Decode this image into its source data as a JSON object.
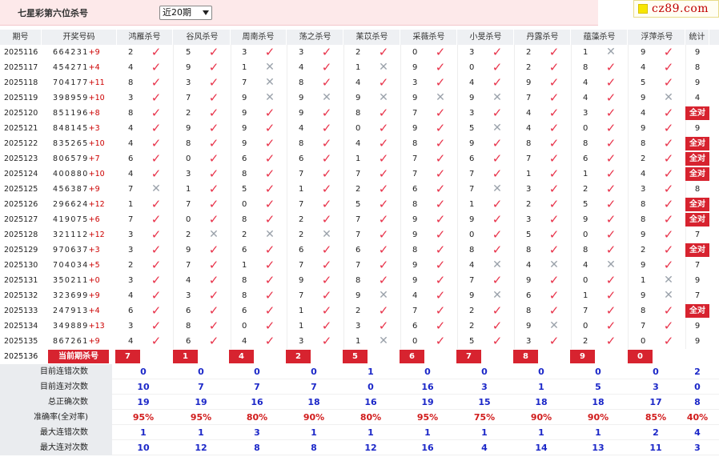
{
  "page": {
    "title": "七星彩第六位杀号",
    "range_select": "近20期"
  },
  "brand": {
    "text": "cz89.com"
  },
  "table": {
    "headers": [
      "期号",
      "开奖号码",
      "鸿雁杀号",
      "谷风杀号",
      "周南杀号",
      "荡之杀号",
      "苿苡杀号",
      "采薇杀号",
      "小旻杀号",
      "丹露杀号",
      "蕴藻杀号",
      "浮萍杀号",
      "统计"
    ],
    "rows": [
      {
        "period": "2025116",
        "digits": "664231",
        "sum": "+9",
        "nums": [
          "2",
          "5",
          "3",
          "3",
          "2",
          "0",
          "3",
          "2",
          "1",
          "9"
        ],
        "marks": [
          "y",
          "y",
          "y",
          "y",
          "y",
          "y",
          "y",
          "y",
          "n",
          "y"
        ],
        "stat": "9"
      },
      {
        "period": "2025117",
        "digits": "454271",
        "sum": "+4",
        "nums": [
          "4",
          "9",
          "1",
          "4",
          "1",
          "9",
          "0",
          "2",
          "8",
          "4"
        ],
        "marks": [
          "y",
          "y",
          "n",
          "y",
          "n",
          "y",
          "y",
          "y",
          "y",
          "y"
        ],
        "stat": "8"
      },
      {
        "period": "2025118",
        "digits": "704177",
        "sum": "+11",
        "nums": [
          "8",
          "3",
          "7",
          "8",
          "4",
          "3",
          "4",
          "9",
          "4",
          "5"
        ],
        "marks": [
          "y",
          "y",
          "n",
          "y",
          "y",
          "y",
          "y",
          "y",
          "y",
          "y"
        ],
        "stat": "9"
      },
      {
        "period": "2025119",
        "digits": "398959",
        "sum": "+10",
        "nums": [
          "3",
          "7",
          "9",
          "9",
          "9",
          "9",
          "9",
          "7",
          "4",
          "9"
        ],
        "marks": [
          "y",
          "y",
          "n",
          "n",
          "n",
          "n",
          "n",
          "y",
          "y",
          "n"
        ],
        "stat": "4"
      },
      {
        "period": "2025120",
        "digits": "851196",
        "sum": "+8",
        "nums": [
          "8",
          "2",
          "9",
          "9",
          "8",
          "7",
          "3",
          "4",
          "3",
          "4"
        ],
        "marks": [
          "y",
          "y",
          "y",
          "y",
          "y",
          "y",
          "y",
          "y",
          "y",
          "y"
        ],
        "stat": "全对"
      },
      {
        "period": "2025121",
        "digits": "848145",
        "sum": "+3",
        "nums": [
          "4",
          "9",
          "9",
          "4",
          "0",
          "9",
          "5",
          "4",
          "0",
          "9"
        ],
        "marks": [
          "y",
          "y",
          "y",
          "y",
          "y",
          "y",
          "n",
          "y",
          "y",
          "y"
        ],
        "stat": "9"
      },
      {
        "period": "2025122",
        "digits": "835265",
        "sum": "+10",
        "nums": [
          "4",
          "8",
          "9",
          "8",
          "4",
          "8",
          "9",
          "8",
          "8",
          "8"
        ],
        "marks": [
          "y",
          "y",
          "y",
          "y",
          "y",
          "y",
          "y",
          "y",
          "y",
          "y"
        ],
        "stat": "全对"
      },
      {
        "period": "2025123",
        "digits": "806579",
        "sum": "+7",
        "nums": [
          "6",
          "0",
          "6",
          "6",
          "1",
          "7",
          "6",
          "7",
          "6",
          "2"
        ],
        "marks": [
          "y",
          "y",
          "y",
          "y",
          "y",
          "y",
          "y",
          "y",
          "y",
          "y"
        ],
        "stat": "全对"
      },
      {
        "period": "2025124",
        "digits": "400880",
        "sum": "+10",
        "nums": [
          "4",
          "3",
          "8",
          "7",
          "7",
          "7",
          "7",
          "1",
          "1",
          "4"
        ],
        "marks": [
          "y",
          "y",
          "y",
          "y",
          "y",
          "y",
          "y",
          "y",
          "y",
          "y"
        ],
        "stat": "全对"
      },
      {
        "period": "2025125",
        "digits": "456387",
        "sum": "+9",
        "nums": [
          "7",
          "1",
          "5",
          "1",
          "2",
          "6",
          "7",
          "3",
          "2",
          "3"
        ],
        "marks": [
          "n",
          "y",
          "y",
          "y",
          "y",
          "y",
          "n",
          "y",
          "y",
          "y"
        ],
        "stat": "8"
      },
      {
        "period": "2025126",
        "digits": "296624",
        "sum": "+12",
        "nums": [
          "1",
          "7",
          "0",
          "7",
          "5",
          "8",
          "1",
          "2",
          "5",
          "8"
        ],
        "marks": [
          "y",
          "y",
          "y",
          "y",
          "y",
          "y",
          "y",
          "y",
          "y",
          "y"
        ],
        "stat": "全对"
      },
      {
        "period": "2025127",
        "digits": "419075",
        "sum": "+6",
        "nums": [
          "7",
          "0",
          "8",
          "2",
          "7",
          "9",
          "9",
          "3",
          "9",
          "8"
        ],
        "marks": [
          "y",
          "y",
          "y",
          "y",
          "y",
          "y",
          "y",
          "y",
          "y",
          "y"
        ],
        "stat": "全对"
      },
      {
        "period": "2025128",
        "digits": "321112",
        "sum": "+12",
        "nums": [
          "3",
          "2",
          "2",
          "2",
          "7",
          "9",
          "0",
          "5",
          "0",
          "9"
        ],
        "marks": [
          "y",
          "n",
          "n",
          "n",
          "y",
          "y",
          "y",
          "y",
          "y",
          "y"
        ],
        "stat": "7"
      },
      {
        "period": "2025129",
        "digits": "970637",
        "sum": "+3",
        "nums": [
          "3",
          "9",
          "6",
          "6",
          "6",
          "8",
          "8",
          "8",
          "8",
          "2"
        ],
        "marks": [
          "y",
          "y",
          "y",
          "y",
          "y",
          "y",
          "y",
          "y",
          "y",
          "y"
        ],
        "stat": "全对"
      },
      {
        "period": "2025130",
        "digits": "704034",
        "sum": "+5",
        "nums": [
          "2",
          "7",
          "1",
          "7",
          "7",
          "9",
          "4",
          "4",
          "4",
          "9"
        ],
        "marks": [
          "y",
          "y",
          "y",
          "y",
          "y",
          "y",
          "n",
          "n",
          "n",
          "y"
        ],
        "stat": "7"
      },
      {
        "period": "2025131",
        "digits": "350211",
        "sum": "+0",
        "nums": [
          "3",
          "4",
          "8",
          "9",
          "8",
          "9",
          "7",
          "9",
          "0",
          "1"
        ],
        "marks": [
          "y",
          "y",
          "y",
          "y",
          "y",
          "y",
          "y",
          "y",
          "y",
          "n"
        ],
        "stat": "9"
      },
      {
        "period": "2025132",
        "digits": "323699",
        "sum": "+9",
        "nums": [
          "4",
          "3",
          "8",
          "7",
          "9",
          "4",
          "9",
          "6",
          "1",
          "9"
        ],
        "marks": [
          "y",
          "y",
          "y",
          "y",
          "n",
          "y",
          "n",
          "y",
          "y",
          "n"
        ],
        "stat": "7"
      },
      {
        "period": "2025133",
        "digits": "247913",
        "sum": "+4",
        "nums": [
          "6",
          "6",
          "6",
          "1",
          "2",
          "7",
          "2",
          "8",
          "7",
          "8"
        ],
        "marks": [
          "y",
          "y",
          "y",
          "y",
          "y",
          "y",
          "y",
          "y",
          "y",
          "y"
        ],
        "stat": "全对"
      },
      {
        "period": "2025134",
        "digits": "349889",
        "sum": "+13",
        "nums": [
          "3",
          "8",
          "0",
          "1",
          "3",
          "6",
          "2",
          "9",
          "0",
          "7"
        ],
        "marks": [
          "y",
          "y",
          "y",
          "y",
          "y",
          "y",
          "y",
          "n",
          "y",
          "y"
        ],
        "stat": "9"
      },
      {
        "period": "2025135",
        "digits": "867261",
        "sum": "+9",
        "nums": [
          "4",
          "6",
          "4",
          "3",
          "1",
          "0",
          "5",
          "3",
          "2",
          "0"
        ],
        "marks": [
          "y",
          "y",
          "y",
          "y",
          "n",
          "y",
          "y",
          "y",
          "y",
          "y"
        ],
        "stat": "9"
      }
    ],
    "current": {
      "period": "2025136",
      "badge": "当前期杀号",
      "nums": [
        "7",
        "1",
        "4",
        "2",
        "5",
        "6",
        "7",
        "8",
        "9",
        "0"
      ]
    }
  },
  "summary": [
    {
      "label": "目前连错次数",
      "values": [
        "0",
        "0",
        "0",
        "0",
        "1",
        "0",
        "0",
        "0",
        "0",
        "0"
      ],
      "stat": "2",
      "color": "blue"
    },
    {
      "label": "目前连对次数",
      "values": [
        "10",
        "7",
        "7",
        "7",
        "0",
        "16",
        "3",
        "1",
        "5",
        "3"
      ],
      "stat": "0",
      "color": "blue"
    },
    {
      "label": "总正确次数",
      "values": [
        "19",
        "19",
        "16",
        "18",
        "16",
        "19",
        "15",
        "18",
        "18",
        "17"
      ],
      "stat": "8",
      "color": "blue"
    },
    {
      "label": "准确率(全对率)",
      "values": [
        "95%",
        "95%",
        "80%",
        "90%",
        "80%",
        "95%",
        "75%",
        "90%",
        "90%",
        "85%"
      ],
      "stat": "40%",
      "color": "red"
    },
    {
      "label": "最大连错次数",
      "values": [
        "1",
        "1",
        "3",
        "1",
        "1",
        "1",
        "1",
        "1",
        "1",
        "2"
      ],
      "stat": "4",
      "color": "blue"
    },
    {
      "label": "最大连对次数",
      "values": [
        "10",
        "12",
        "8",
        "8",
        "12",
        "16",
        "4",
        "14",
        "13",
        "11"
      ],
      "stat": "3",
      "color": "blue"
    }
  ],
  "icons": {
    "correct": "check-icon",
    "wrong": "cross-icon"
  },
  "colors": {
    "accent_red": "#d7232f",
    "check_red": "#e8324a",
    "cross_gray": "#9aa1aa",
    "summary_blue": "#1b27c8",
    "summary_red": "#d11c1c",
    "header_bg": "#eef0f3",
    "topbar_bg": "#fde9ea"
  }
}
